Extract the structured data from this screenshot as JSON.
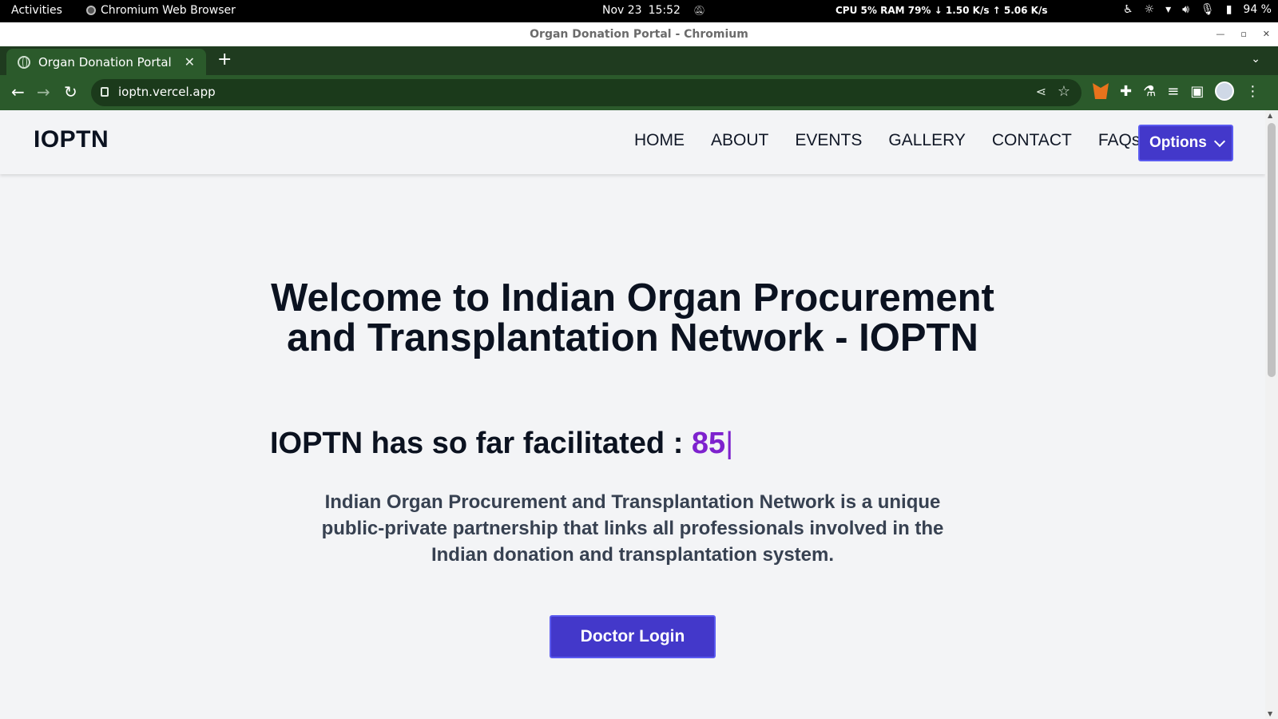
{
  "system_bar": {
    "activities": "Activities",
    "app_name": "Chromium Web Browser",
    "date": "Nov 23",
    "time": "15:52",
    "stats": "CPU   5% RAM  79% ↓ 1.50 K/s ↑ 5.06 K/s",
    "battery": "94 %"
  },
  "window": {
    "title": "Organ Donation Portal - Chromium"
  },
  "browser": {
    "tab_title": "Organ Donation Portal",
    "url": "ioptn.vercel.app"
  },
  "site": {
    "brand": "IOPTN",
    "nav": [
      "HOME",
      "ABOUT",
      "EVENTS",
      "GALLERY",
      "CONTACT",
      "FAQs"
    ],
    "options_label": "Options",
    "hero_title": "Welcome to Indian Organ Procurement and Transplantation Network - IOPTN",
    "facilitated_prefix": "IOPTN has so far facilitated : ",
    "facilitated_count": "85",
    "cursor": "|",
    "description": "Indian Organ Procurement and Transplantation Network is a unique public-private partnership that links all professionals involved in the Indian donation and transplantation system.",
    "cta_label": "Doctor Login"
  },
  "colors": {
    "browser_theme": "#2b5a2b",
    "primary_button": "#4338ca",
    "count_accent": "#7e22ce",
    "page_background": "#f3f4f6"
  }
}
